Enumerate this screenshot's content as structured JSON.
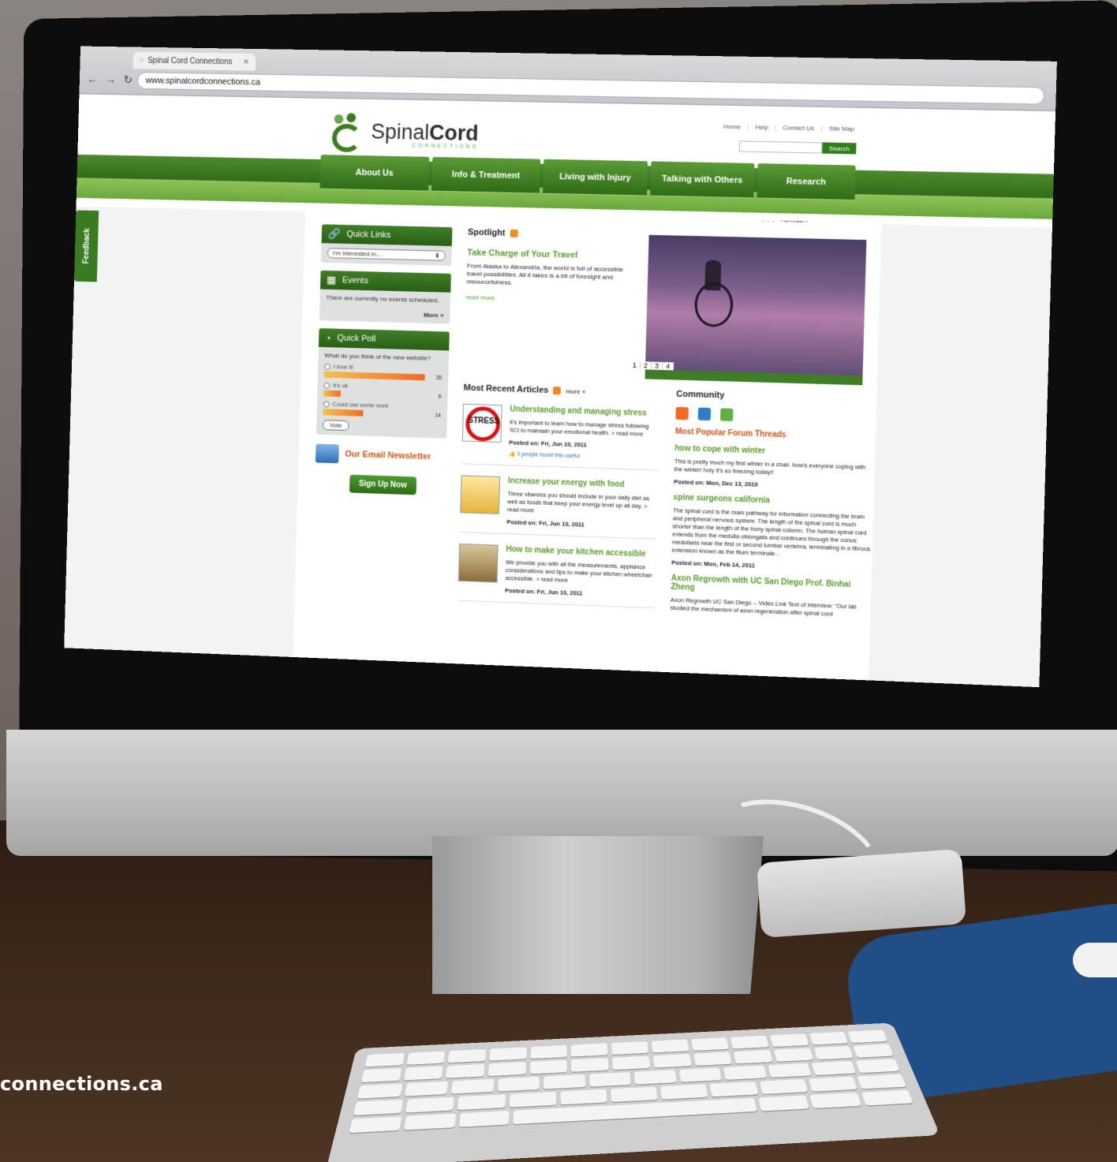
{
  "browser": {
    "tab_title": "Spinal Cord Connections",
    "url": "www.spinalcordconnections.ca"
  },
  "site": {
    "brand_regular": "Spinal",
    "brand_bold": "Cord",
    "brand_sub": "CONNECTIONS"
  },
  "top_links": [
    "Home",
    "Help",
    "Contact Us",
    "Site Map"
  ],
  "search": {
    "button": "Search",
    "placeholder": ""
  },
  "nav": [
    "About Us",
    "Info & Treatment",
    "Living with Injury",
    "Talking with Others",
    "Research"
  ],
  "tools": {
    "text_size": "AAA",
    "share": "SHARE"
  },
  "feedback": "Feedback",
  "quick_links": {
    "title": "Quick Links",
    "select_value": "I'm interested in..."
  },
  "events": {
    "title": "Events",
    "text": "There are currently no events scheduled.",
    "more": "More »"
  },
  "poll": {
    "title": "Quick Poll",
    "question": "What do you think of the new website?",
    "options": [
      {
        "label": "I love it!",
        "count": "35",
        "fraction": 1.0
      },
      {
        "label": "It's ok",
        "count": "6",
        "fraction": 0.17
      },
      {
        "label": "Could use some work",
        "count": "14",
        "fraction": 0.4
      }
    ],
    "vote": "Vote"
  },
  "newsletter": {
    "title": "Our Email Newsletter",
    "button": "Sign Up Now"
  },
  "spotlight": {
    "heading": "Spotlight",
    "title": "Take Charge of Your Travel",
    "text": "From Alaska to Alexandria, the world is full of accessible travel possibilities. All it takes is a bit of foresight and resourcefulness.",
    "read_more": "read more",
    "pages": [
      "1",
      "2",
      "3",
      "4"
    ]
  },
  "recent": {
    "heading": "Most Recent Articles",
    "more": "more »",
    "articles": [
      {
        "title": "Understanding and managing stress",
        "text": "It's important to learn how to manage stress following SCI to maintain your emotional health. > read more",
        "posted": "Posted on: Fri, Jun 10, 2011",
        "useful": "0 people found this useful"
      },
      {
        "title": "Increase your energy with food",
        "text": "Three vitamins you should include in your daily diet as well as foods that keep your energy level up all day. > read more",
        "posted": "Posted on: Fri, Jun 10, 2011"
      },
      {
        "title": "How to make your kitchen accessible",
        "text": "We provide you with all the measurements, appliance considerations and tips to make your kitchen wheelchair accessible. > read more",
        "posted": "Posted on: Fri, Jun 10, 2011"
      }
    ]
  },
  "community": {
    "heading": "Community",
    "popular": "Most Popular Forum Threads",
    "threads": [
      {
        "title": "how to cope with winter",
        "text": "This is pretty much my first winter in a chair. how's everyone coping with the winter! holy it's so freezing today!!",
        "posted": "Posted on: Mon, Dec 13, 2010"
      },
      {
        "title": "spine surgeons california",
        "text": "The spinal cord is the main pathway for information connecting the brain and peripheral nervous system. The length of the spinal cord is much shorter than the length of the bony spinal column. The human spinal cord extends from the medulla oblongata and continues through the conus medullaris near the first or second lumbar vertebra, terminating in a fibrous extension known as the filum terminale...",
        "posted": "Posted on: Mon, Feb 14, 2011"
      },
      {
        "title": "Axon Regrowth with UC San Diego Prof. Binhai Zheng",
        "text": "Axon Regrowth UC San Diego -- Video Link Text of interview: \"Our lab studied the mechanism of axon regeneration after spinal cord"
      }
    ]
  },
  "caption": "connections.ca",
  "colors": {
    "brand_green": "#3c7d22",
    "accent_orange": "#d25418",
    "link_green": "#5a9a2c"
  }
}
